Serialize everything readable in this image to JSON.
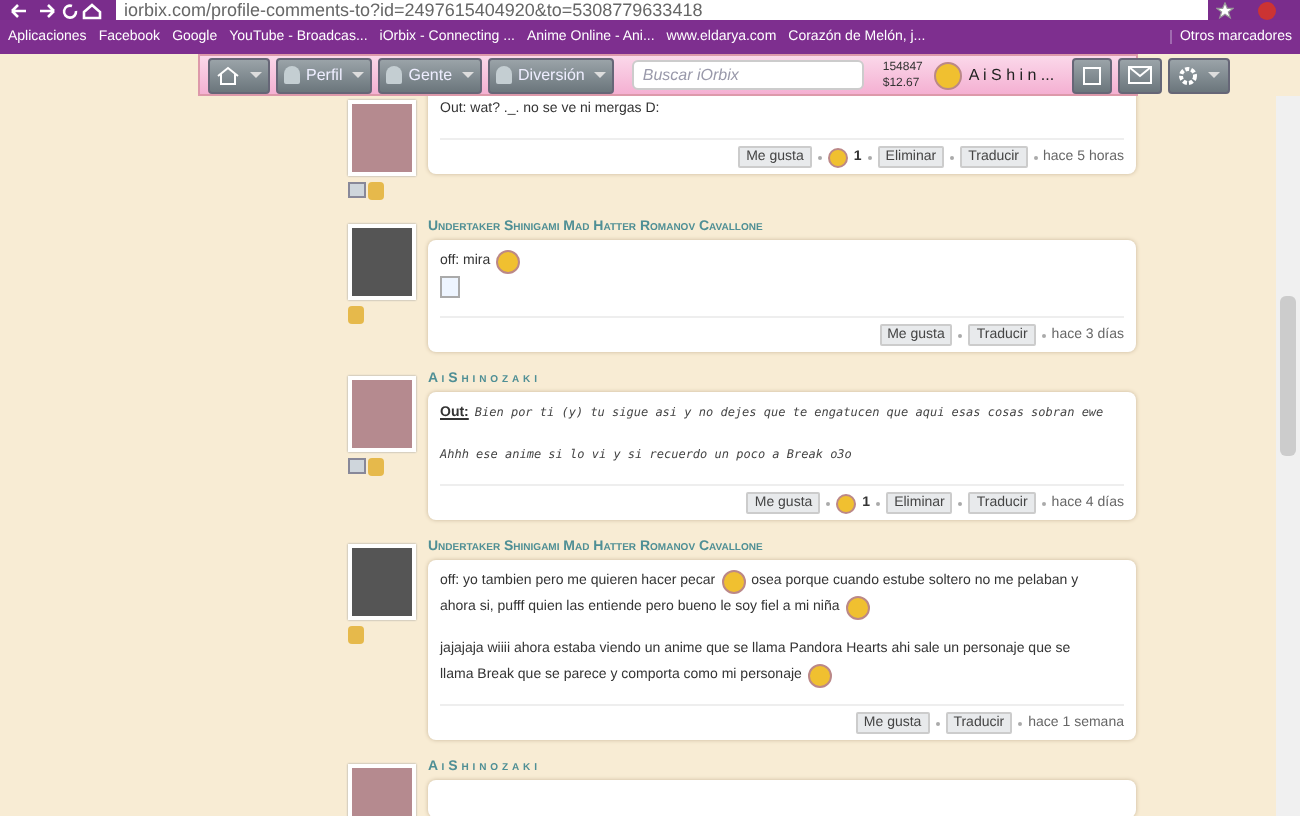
{
  "browser": {
    "url": "iorbix.com/profile-comments-to?id=2497615404920&to=5308779633418",
    "bookmarks": [
      "Aplicaciones",
      "Facebook",
      "Google",
      "YouTube - Broadcas...",
      "iOrbix - Connecting ...",
      "Anime Online - Ani...",
      "www.eldarya.com",
      "Corazón de Melón, j..."
    ],
    "other_bookmarks": "Otros marcadores"
  },
  "nav": {
    "menus": [
      "Perfil",
      "Gente",
      "Diversión"
    ],
    "search": {
      "placeholder": "Buscar iOrbix"
    },
    "points": "154847",
    "money": "$12.67",
    "user": "A i S h i n ..."
  },
  "comments": [
    {
      "card_badge": true,
      "medal_badge": true,
      "paragraphs": [
        [
          [
            {
              "kind": "text",
              "text": "Out: wat? ._. no se ve ni mergas D:"
            }
          ]
        ]
      ],
      "likes": "1",
      "actions": [
        "Me gusta",
        "Eliminar",
        "Traducir"
      ],
      "time": "hace 5 horas"
    },
    {
      "name": "Undertaker Shinigami Mad Hatter Romanov Cavallone",
      "card_badge": false,
      "medal_badge": true,
      "paragraphs": [
        [
          [
            {
              "kind": "text",
              "text": "off: mira"
            },
            {
              "kind": "emoji"
            }
          ],
          [
            {
              "kind": "image"
            }
          ]
        ]
      ],
      "actions": [
        "Me gusta",
        "Traducir"
      ],
      "time": "hace 3 días"
    },
    {
      "name": "A i S h i n o z a k i",
      "card_badge": true,
      "medal_badge": true,
      "paragraphs": [
        [
          [
            {
              "kind": "label",
              "text": "Out:"
            },
            {
              "kind": "mono",
              "text": "Bien por ti (y) tu sigue asi y no dejes que te engatucen que aqui esas cosas sobran ewe"
            }
          ]
        ],
        [
          [
            {
              "kind": "mono",
              "text": "Ahhh ese anime si lo vi y si recuerdo un poco a Break o3o"
            }
          ]
        ]
      ],
      "likes": "1",
      "actions": [
        "Me gusta",
        "Eliminar",
        "Traducir"
      ],
      "time": "hace 4 días"
    },
    {
      "name": "Undertaker Shinigami Mad Hatter Romanov Cavallone",
      "card_badge": false,
      "medal_badge": true,
      "paragraphs": [
        [
          [
            {
              "kind": "text",
              "text": "off: yo tambien pero me quieren hacer pecar"
            },
            {
              "kind": "emoji"
            },
            {
              "kind": "text",
              "text": "osea porque cuando estube soltero no me pelaban y"
            }
          ],
          [
            {
              "kind": "text",
              "text": "ahora si, pufff quien las entiende pero bueno le soy fiel a mi niña"
            },
            {
              "kind": "emoji"
            }
          ]
        ],
        [
          [
            {
              "kind": "text",
              "text": "jajajaja wiiii ahora estaba viendo un anime que se llama Pandora Hearts ahi sale un personaje que se"
            }
          ],
          [
            {
              "kind": "text",
              "text": "llama Break que se parece y comporta como mi personaje"
            },
            {
              "kind": "emoji"
            }
          ]
        ]
      ],
      "actions": [
        "Me gusta",
        "Traducir"
      ],
      "time": "hace 1 semana"
    },
    {
      "name": "A i S h i n o z a k i"
    }
  ]
}
